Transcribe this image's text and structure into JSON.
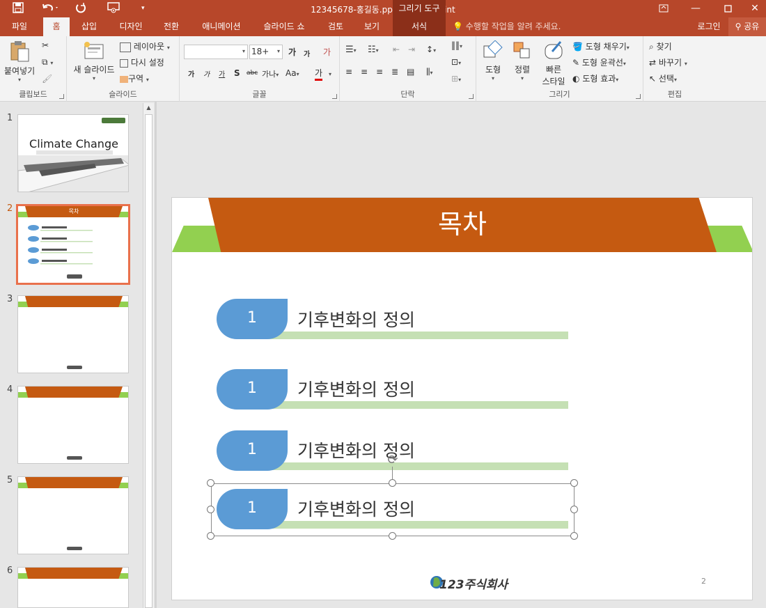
{
  "window": {
    "title": "12345678-홍길동.pptx - PowerPoint",
    "context_group": "그리기 도구"
  },
  "tabs": [
    "파일",
    "홈",
    "삽입",
    "디자인",
    "전환",
    "애니메이션",
    "슬라이드 쇼",
    "검토",
    "보기",
    "서식"
  ],
  "tell_me": "수행할 작업을 알려 주세요.",
  "account": {
    "login": "로그인",
    "share": "공유"
  },
  "ribbon": {
    "clipboard": {
      "label": "클립보드",
      "paste": "붙여넣기"
    },
    "slides": {
      "label": "슬라이드",
      "new_slide": "새 슬라이드",
      "layout": "레이아웃",
      "reset": "다시 설정",
      "section": "구역"
    },
    "font": {
      "label": "글꼴",
      "font_name": "",
      "font_size": "18+",
      "grow": "가",
      "shrink": "가",
      "clear": "가",
      "bold": "가",
      "italic": "가",
      "underline": "가",
      "shadow": "S",
      "strike": "abc",
      "spacing": "가나",
      "case": "Aa",
      "color": "가"
    },
    "paragraph": {
      "label": "단락"
    },
    "drawing": {
      "label": "그리기",
      "shape": "도형",
      "arrange": "정렬",
      "quick_styles_1": "빠른",
      "quick_styles_2": "스타일",
      "fill": "도형 채우기",
      "outline": "도형 윤곽선",
      "effects": "도형 효과"
    },
    "editing": {
      "label": "편집",
      "find": "찾기",
      "replace": "바꾸기",
      "select": "선택"
    }
  },
  "thumbnails": [
    {
      "num": "1",
      "title": "Climate Change"
    },
    {
      "num": "2",
      "title": "목차"
    },
    {
      "num": "3"
    },
    {
      "num": "4"
    },
    {
      "num": "5"
    },
    {
      "num": "6"
    }
  ],
  "slide": {
    "title": "목차",
    "items": [
      {
        "num": "1",
        "text": "기후변화의 정의"
      },
      {
        "num": "1",
        "text": "기후변화의 정의"
      },
      {
        "num": "1",
        "text": "기후변화의 정의"
      },
      {
        "num": "1",
        "text": "기후변화의 정의"
      }
    ],
    "logo": "123주식회사",
    "page_number": "2"
  },
  "colors": {
    "accent": "#b7472a",
    "banner": "#c55a11",
    "green": "#92d050",
    "bubble": "#5b9bd5",
    "underline": "#c5e0b4"
  }
}
